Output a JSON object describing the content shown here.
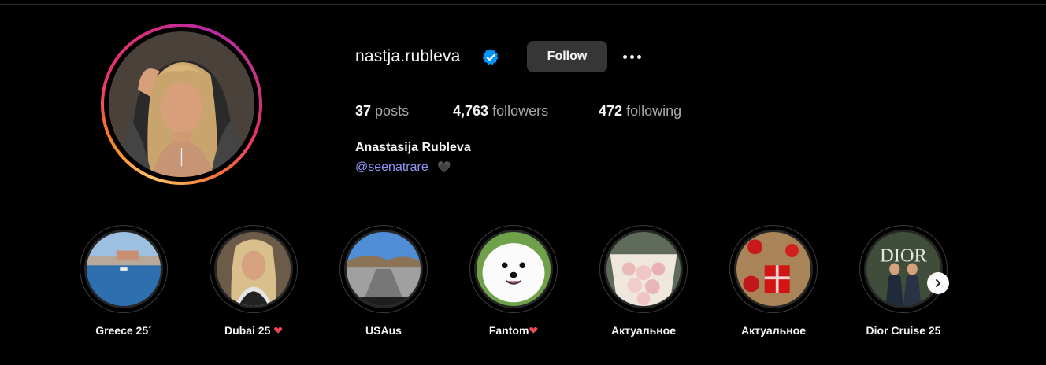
{
  "profile": {
    "username": "nastja.rubleva",
    "verified_icon": "verified-badge-icon",
    "follow_label": "Follow",
    "more_icon": "more-options-icon",
    "posts_count": "37",
    "posts_label": "posts",
    "followers_count": "4,763",
    "followers_label": "followers",
    "following_count": "472",
    "following_label": "following",
    "full_name": "Anastasija Rubleva",
    "bio_handle": "@seenatrare",
    "bio_heart": "🖤",
    "accent_color": "#8f96f8",
    "verified_color": "#0095f6"
  },
  "highlights": [
    {
      "label": "Greece 25´",
      "heart": ""
    },
    {
      "label": "Dubai 25",
      "heart": "❤"
    },
    {
      "label": "USAus",
      "heart": ""
    },
    {
      "label": "Fantom",
      "heart": "❤"
    },
    {
      "label": "Актуальное",
      "heart": ""
    },
    {
      "label": "Актуальное",
      "heart": ""
    },
    {
      "label": "Dior Cruise 25",
      "heart": ""
    }
  ],
  "highlight_image_text": {
    "dior": "DIOR"
  },
  "next_icon": "chevron-right-icon"
}
